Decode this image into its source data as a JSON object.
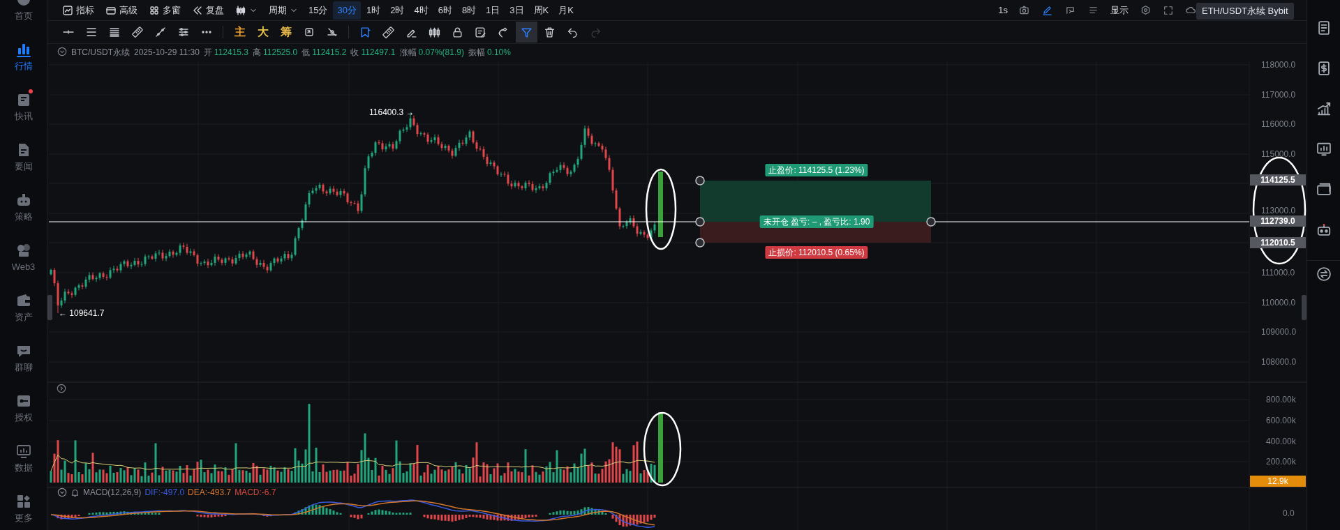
{
  "sidebar": {
    "items": [
      {
        "label": "首页",
        "selected": false,
        "badge": false
      },
      {
        "label": "行情",
        "selected": true,
        "badge": false
      },
      {
        "label": "快讯",
        "selected": false,
        "badge": true
      },
      {
        "label": "要闻",
        "selected": false,
        "badge": false
      },
      {
        "label": "策略",
        "selected": false,
        "badge": false
      },
      {
        "label": "Web3",
        "selected": false,
        "badge": false
      },
      {
        "label": "资产",
        "selected": false,
        "badge": false
      },
      {
        "label": "群聊",
        "selected": false,
        "badge": false
      },
      {
        "label": "授权",
        "selected": false,
        "badge": false
      },
      {
        "label": "数据",
        "selected": false,
        "badge": false
      },
      {
        "label": "更多",
        "selected": false,
        "badge": false
      }
    ]
  },
  "toolbar": {
    "menus": [
      {
        "label": "指标"
      },
      {
        "label": "高级"
      },
      {
        "label": "多窗"
      },
      {
        "label": "复盘"
      }
    ],
    "period_label": "周期",
    "intervals": [
      {
        "label": "15分",
        "selected": false
      },
      {
        "label": "30分",
        "selected": true
      },
      {
        "label": "1时",
        "selected": false
      },
      {
        "label": "2时",
        "selected": false
      },
      {
        "label": "4时",
        "selected": false
      },
      {
        "label": "6时",
        "selected": false
      },
      {
        "label": "8时",
        "selected": false
      },
      {
        "label": "1日",
        "selected": false
      },
      {
        "label": "3日",
        "selected": false
      },
      {
        "label": "周K",
        "selected": false
      },
      {
        "label": "月K",
        "selected": false
      }
    ],
    "refresh": "1s",
    "actions": [
      {
        "on": false
      },
      {
        "on": true
      },
      {
        "on": false
      },
      {
        "on": false
      }
    ],
    "display": "显示"
  },
  "tooltip": {
    "text": "ETH/USDT永续 Bybit"
  },
  "drawing_bar": {
    "text_tools": [
      {
        "label": "主",
        "color": "#f0a030"
      },
      {
        "label": "大",
        "color": "#e8c44a"
      },
      {
        "label": "筹",
        "color": "#e8b848"
      }
    ],
    "tools": [
      {
        "on": true,
        "selected": false,
        "disabled": false
      },
      {
        "on": false,
        "selected": false,
        "disabled": false
      },
      {
        "on": false,
        "selected": false,
        "disabled": false
      },
      {
        "on": false,
        "selected": false,
        "disabled": false
      },
      {
        "on": false,
        "selected": false,
        "disabled": false
      },
      {
        "on": false,
        "selected": false,
        "disabled": false
      },
      {
        "on": false,
        "selected": false,
        "disabled": false
      },
      {
        "on": true,
        "selected": true,
        "disabled": false
      },
      {
        "on": false,
        "selected": false,
        "disabled": false
      },
      {
        "on": false,
        "selected": false,
        "disabled": false
      },
      {
        "on": false,
        "selected": false,
        "disabled": true
      }
    ]
  },
  "legend": {
    "symbol": "BTC/USDT永续",
    "time": "2025-10-29 11:30",
    "fields": [
      {
        "label": "开",
        "value": "112415.3"
      },
      {
        "label": "高",
        "value": "112525.0"
      },
      {
        "label": "低",
        "value": "112415.2"
      },
      {
        "label": "收",
        "value": "112497.1"
      },
      {
        "label": "涨幅",
        "value": "0.07%(81.9)"
      },
      {
        "label": "振幅",
        "value": "0.10%"
      }
    ]
  },
  "price_axis": {
    "ticks": [
      "118000.0",
      "117000.0",
      "116000.0",
      "115000.0",
      "113000.0",
      "111000.0",
      "110000.0",
      "109000.0",
      "108000.0"
    ]
  },
  "price_tags": [
    "114125.5",
    "112739.0",
    "112010.5"
  ],
  "extremes": {
    "high": "116400.3 →",
    "low": "← 109641.7"
  },
  "position": {
    "take_profit": "止盈价: 114125.5 (1.23%)",
    "status": "未开仓 盈亏: – , 盈亏比: 1.90",
    "stop_loss": "止损价: 112010.5 (0.65%)"
  },
  "volume_axis": {
    "ticks": [
      "800.00k",
      "600.00k",
      "400.00k",
      "200.00k"
    ],
    "current": "12.9k"
  },
  "macd": {
    "title": "MACD(12,26,9)",
    "dif": "DIF:-497.0",
    "dea": "DEA:-493.7",
    "macd": "MACD:-6.7",
    "axis": "0.0"
  }
}
